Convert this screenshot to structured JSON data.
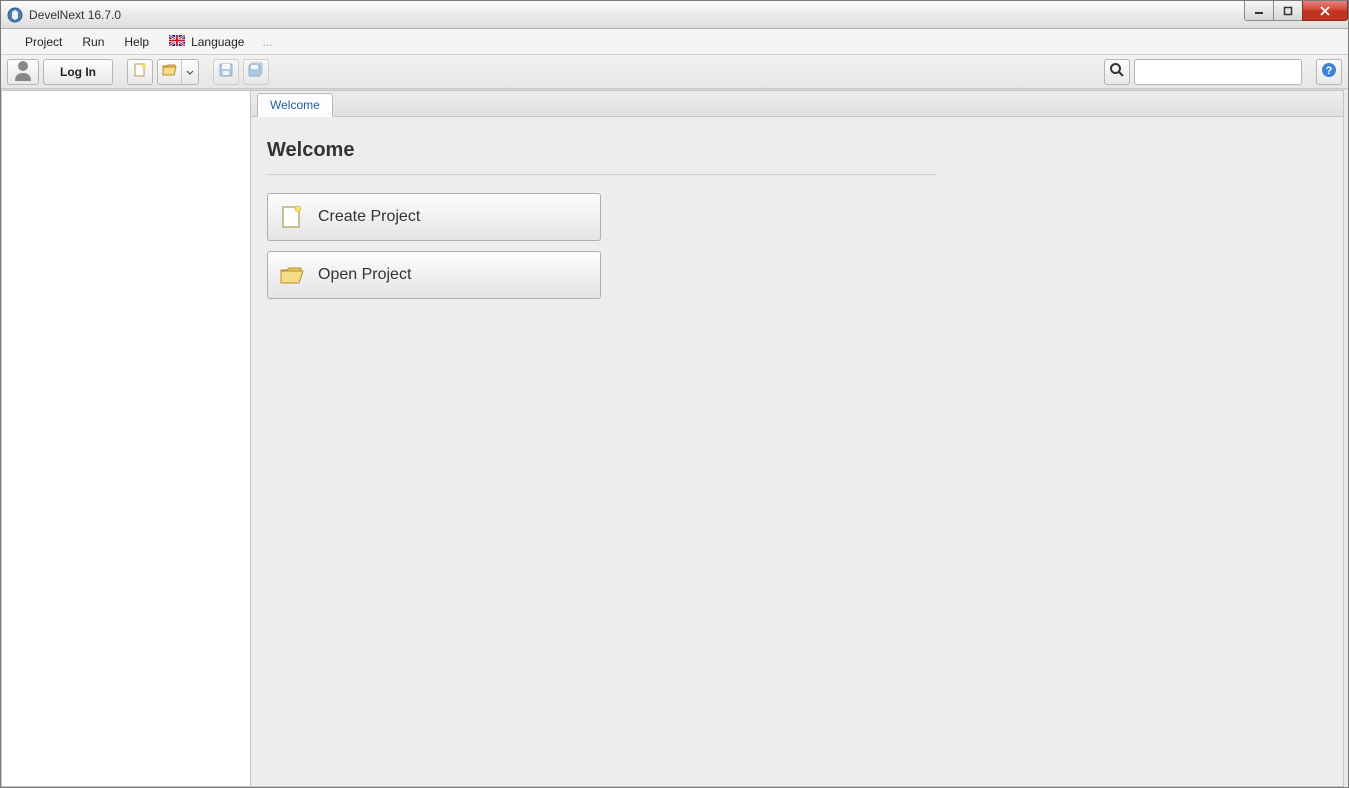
{
  "window": {
    "title": "DevelNext 16.7.0"
  },
  "menubar": {
    "items": [
      "Project",
      "Run",
      "Help"
    ],
    "language_label": "Language",
    "ellipsis": "..."
  },
  "toolbar": {
    "login_label": "Log In",
    "search_value": ""
  },
  "tabs": {
    "welcome": "Welcome"
  },
  "welcome": {
    "heading": "Welcome",
    "create_project": "Create Project",
    "open_project": "Open Project"
  }
}
